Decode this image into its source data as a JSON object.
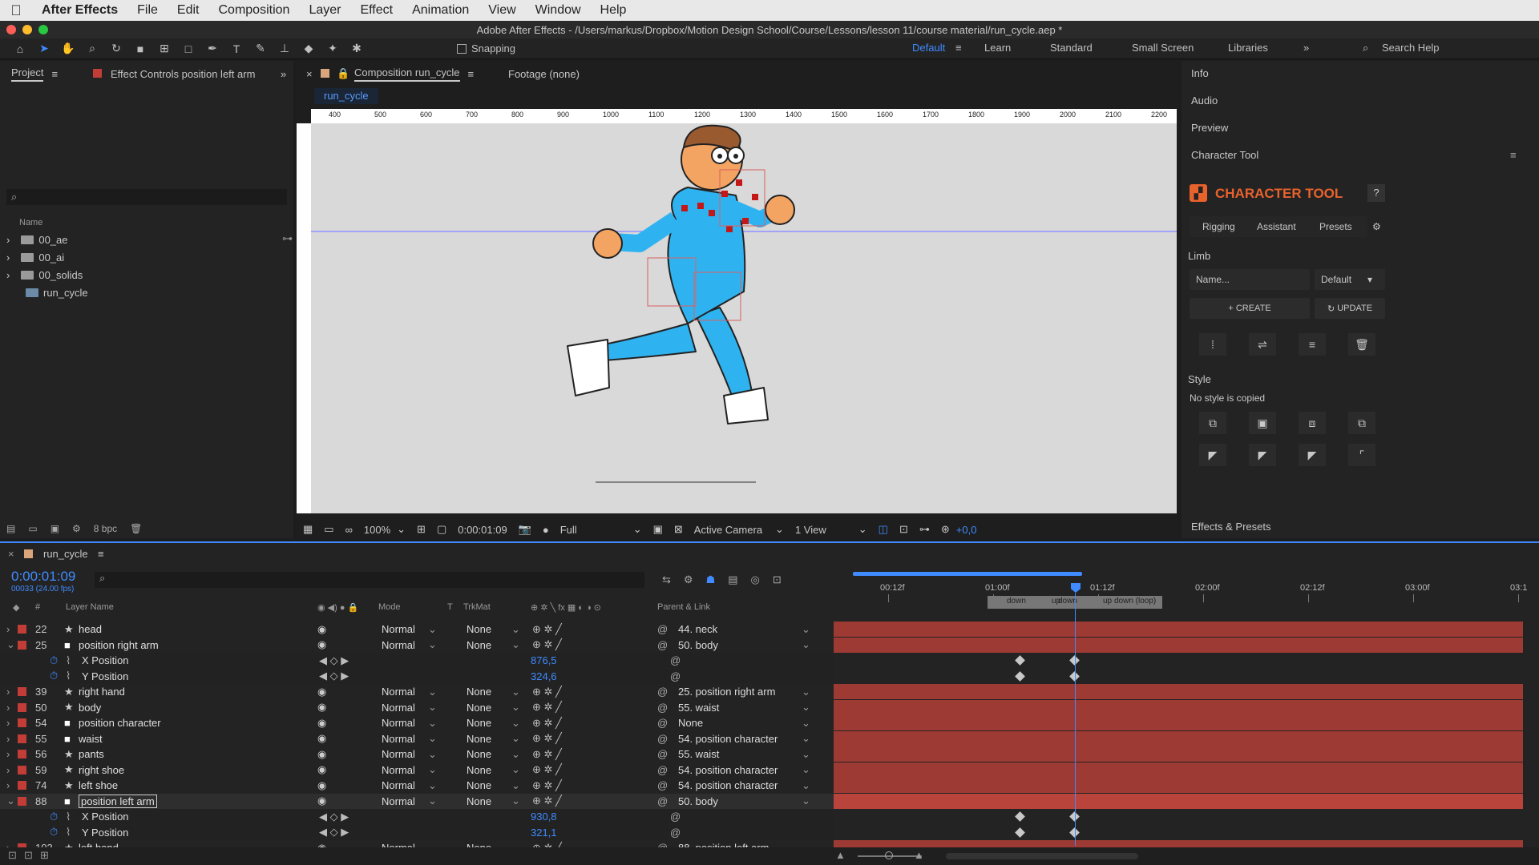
{
  "menubar": {
    "app": "After Effects",
    "items": [
      "File",
      "Edit",
      "Composition",
      "Layer",
      "Effect",
      "Animation",
      "View",
      "Window",
      "Help"
    ]
  },
  "window_title": "Adobe After Effects - /Users/markus/Dropbox/Motion Design School/Course/Lessons/lesson 11/course material/run_cycle.aep *",
  "toolbar": {
    "snapping": "Snapping",
    "workspaces": [
      "Default",
      "Learn",
      "Standard",
      "Small Screen",
      "Libraries"
    ],
    "active_workspace": "Default",
    "search": "Search Help"
  },
  "project": {
    "tab": "Project",
    "effect_tab": "Effect Controls position left arm",
    "col_name": "Name",
    "items": [
      "00_ae",
      "00_ai",
      "00_solids",
      "run_cycle"
    ],
    "bpc": "8 bpc"
  },
  "viewer": {
    "comp_tab": "Composition run_cycle",
    "footage_tab": "Footage (none)",
    "comp_name": "run_cycle",
    "ruler": [
      "400",
      "500",
      "600",
      "700",
      "800",
      "900",
      "1000",
      "1100",
      "1200",
      "1300",
      "1400",
      "1500",
      "1600",
      "1700",
      "1800",
      "1900",
      "2000",
      "2100",
      "2200"
    ],
    "zoom": "100%",
    "time": "0:00:01:09",
    "resolution": "Full",
    "camera": "Active Camera",
    "views": "1 View",
    "exposure": "+0,0"
  },
  "right_panel": {
    "info": "Info",
    "audio": "Audio",
    "preview": "Preview",
    "character_tool_tab": "Character Tool",
    "brand": "CHARACTER TOOL",
    "help": "?",
    "tabs": [
      "Rigging",
      "Assistant",
      "Presets"
    ],
    "limb": "Limb",
    "name_placeholder": "Name...",
    "limb_style": "Default",
    "create": "CREATE",
    "update": "UPDATE",
    "style": "Style",
    "no_style": "No style is copied",
    "effects_presets": "Effects & Presets"
  },
  "timeline": {
    "comp_name": "run_cycle",
    "timecode": "0:00:01:09",
    "fps": "00033 (24.00 fps)",
    "headers": {
      "num": "#",
      "layer_name": "Layer Name",
      "mode": "Mode",
      "t": "T",
      "trkmat": "TrkMat",
      "parent": "Parent & Link"
    },
    "ruler": [
      "00:12f",
      "01:00f",
      "01:12f",
      "02:00f",
      "02:12f",
      "03:00f",
      "03:1"
    ],
    "markers": [
      "down",
      "up",
      "down",
      "up",
      "down (loop)"
    ],
    "layers": [
      {
        "num": "22",
        "name": "head",
        "icon": "star",
        "label": "#c23c38",
        "mode": "Normal",
        "trkmat": "None",
        "parent": "44. neck",
        "expanded": false
      },
      {
        "num": "25",
        "name": "position right arm",
        "icon": "solid",
        "label": "#c23c38",
        "mode": "Normal",
        "trkmat": "None",
        "parent": "50. body",
        "expanded": true
      },
      {
        "prop": "X Position",
        "value": "876,5"
      },
      {
        "prop": "Y Position",
        "value": "324,6"
      },
      {
        "num": "39",
        "name": "right hand",
        "icon": "star",
        "label": "#c23c38",
        "mode": "Normal",
        "trkmat": "None",
        "parent": "25. position right arm",
        "expanded": false
      },
      {
        "num": "50",
        "name": "body",
        "icon": "star",
        "label": "#c23c38",
        "mode": "Normal",
        "trkmat": "None",
        "parent": "55. waist",
        "expanded": false
      },
      {
        "num": "54",
        "name": "position character",
        "icon": "solid",
        "label": "#c23c38",
        "mode": "Normal",
        "trkmat": "None",
        "parent": "None",
        "expanded": false
      },
      {
        "num": "55",
        "name": "waist",
        "icon": "solid",
        "label": "#c23c38",
        "mode": "Normal",
        "trkmat": "None",
        "parent": "54. position character",
        "expanded": false
      },
      {
        "num": "56",
        "name": "pants",
        "icon": "star",
        "label": "#c23c38",
        "mode": "Normal",
        "trkmat": "None",
        "parent": "55. waist",
        "expanded": false
      },
      {
        "num": "59",
        "name": "right shoe",
        "icon": "star",
        "label": "#c23c38",
        "mode": "Normal",
        "trkmat": "None",
        "parent": "54. position character",
        "expanded": false
      },
      {
        "num": "74",
        "name": "left shoe",
        "icon": "star",
        "label": "#c23c38",
        "mode": "Normal",
        "trkmat": "None",
        "parent": "54. position character",
        "expanded": false
      },
      {
        "num": "88",
        "name": "position left arm",
        "icon": "solid",
        "label": "#c23c38",
        "mode": "Normal",
        "trkmat": "None",
        "parent": "50. body",
        "expanded": true,
        "selected": true
      },
      {
        "prop": "X Position",
        "value": "930,8"
      },
      {
        "prop": "Y Position",
        "value": "321,1"
      },
      {
        "num": "103",
        "name": "left hand",
        "icon": "star",
        "label": "#c23c38",
        "mode": "Normal",
        "trkmat": "None",
        "parent": "88. position left arm",
        "expanded": false
      }
    ]
  },
  "colors": {
    "accent": "#3f8bff",
    "track": "#9e3a34",
    "brand": "#e8622c"
  }
}
